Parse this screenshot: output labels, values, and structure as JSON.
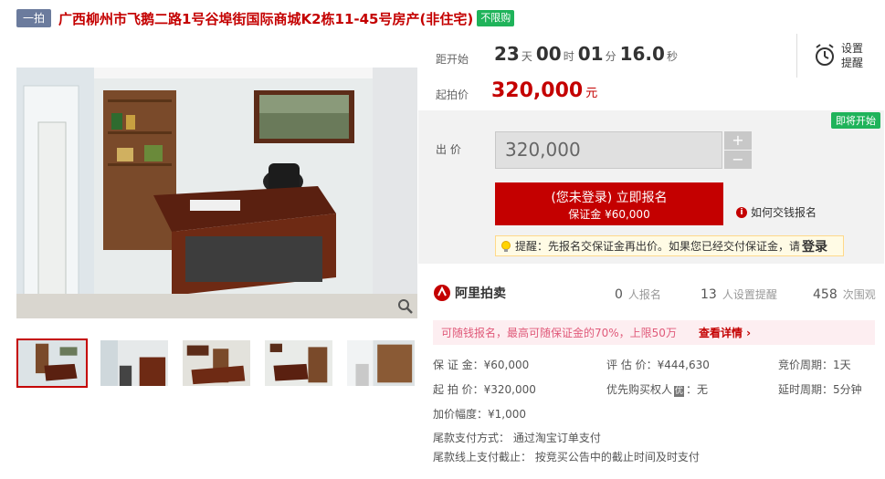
{
  "header": {
    "round_badge": "一拍",
    "title": "广西柳州市飞鹅二路1号谷埠街国际商城K2栋11-45号房产(非住宅)",
    "purchase_badge": "不限购"
  },
  "countdown": {
    "label": "距开始",
    "days": "23",
    "days_unit": "天",
    "hours": "00",
    "hours_unit": "时",
    "minutes": "01",
    "minutes_unit": "分",
    "seconds": "16.0",
    "seconds_unit": "秒"
  },
  "reminder": {
    "label_line1": "设置",
    "label_line2": "提醒",
    "icon": "alarm-clock-icon"
  },
  "start_price": {
    "label": "起拍价",
    "value": "320,000",
    "unit": "元"
  },
  "bid": {
    "status_badge": "即将开始",
    "label": "出 价",
    "input_value": "320,000",
    "plus": "+",
    "minus": "−",
    "signup_main": "(您未登录) 立即报名",
    "signup_sub": "保证金 ¥60,000",
    "help_link": "如何交钱报名",
    "tip_text": "提醒：先报名交保证金再出价。如果您已经交付保证金，请",
    "tip_login": "登录"
  },
  "brand": {
    "name": "阿里拍卖"
  },
  "stats": {
    "signups_num": "0",
    "signups_label": "人报名",
    "reminders_num": "13",
    "reminders_label": "人设置提醒",
    "views_num": "458",
    "views_label": "次围观"
  },
  "loan": {
    "text": "可随钱报名，最高可随保证金的70%，上限50万",
    "link": "查看详情 ›"
  },
  "details": {
    "deposit": "保 证 金：¥60,000",
    "appraisal": "评 估 价：¥444,630",
    "cycle": "竞价周期：1天",
    "start_price": "起 拍 价：¥320,000",
    "priority_label": "优先购买权人",
    "priority_badge": "优",
    "priority_value": "：无",
    "delay": "延时周期：5分钟",
    "increment": "加价幅度：¥1,000",
    "payment_method": "尾款支付方式： 通过淘宝订单支付",
    "payment_deadline": "尾款线上支付截止： 按竞买公告中的截止时间及时支付"
  },
  "colors": {
    "accent": "#c40000",
    "green_badge": "#1fb35a",
    "round_badge": "#6b7b9d"
  }
}
